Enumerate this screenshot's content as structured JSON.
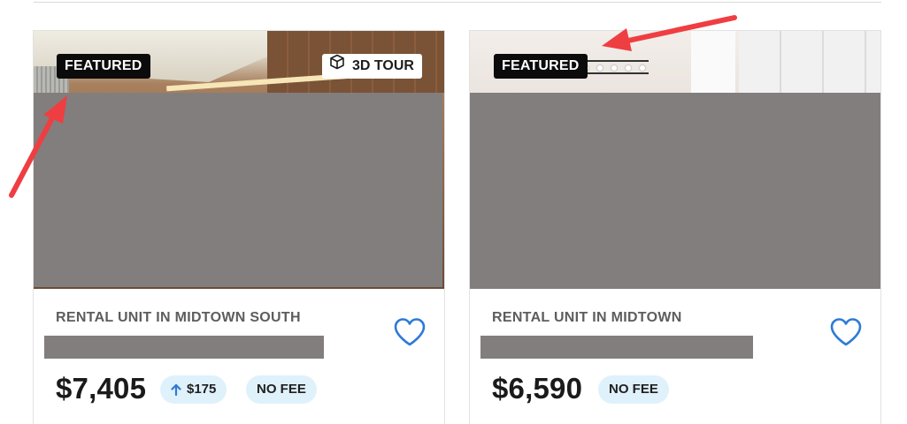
{
  "listings": [
    {
      "featured_label": "FEATURED",
      "tour_label": "3D TOUR",
      "type": "RENTAL UNIT IN MIDTOWN SOUTH",
      "price": "$7,405",
      "price_change": "$175",
      "price_change_direction": "up",
      "no_fee_label": "NO FEE",
      "favorite": false
    },
    {
      "featured_label": "FEATURED",
      "type": "RENTAL UNIT IN MIDTOWN",
      "price": "$6,590",
      "no_fee_label": "NO FEE",
      "favorite": false
    }
  ],
  "colors": {
    "accent_blue": "#2e7bd6",
    "pill_background": "#dff1fb",
    "annotation_arrow": "#ef3e42",
    "redaction": "#827e7d"
  },
  "icons": [
    "cube-icon",
    "heart-icon",
    "arrow-up-icon"
  ]
}
